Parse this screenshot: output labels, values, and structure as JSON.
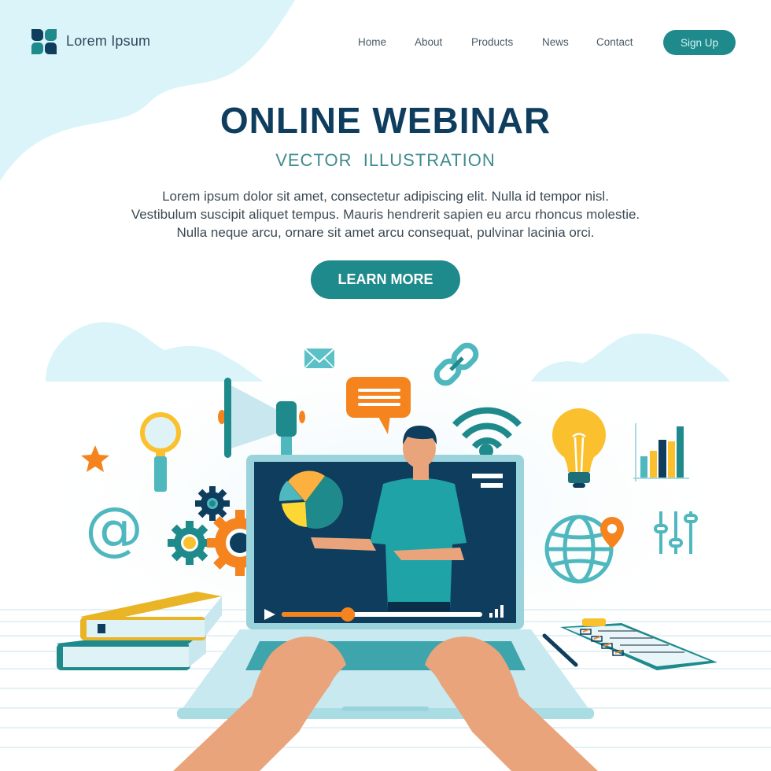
{
  "header": {
    "brand_name": "Lorem Ipsum",
    "logo_icon": "four-leaf-logo-icon",
    "nav": [
      {
        "label": "Home"
      },
      {
        "label": "About"
      },
      {
        "label": "Products"
      },
      {
        "label": "News"
      },
      {
        "label": "Contact"
      }
    ],
    "signup_label": "Sign Up"
  },
  "hero": {
    "title": "ONLINE WEBINAR",
    "subtitle": "VECTOR  ILLUSTRATION",
    "body_lines": [
      "Lorem ipsum dolor sit amet, consectetur adipiscing elit. Nulla id tempor nisl.",
      "Vestibulum suscipit aliquet tempus. Mauris hendrerit sapien eu arcu rhoncus molestie.",
      "Nulla neque arcu, ornare sit amet arcu consequat, pulvinar lacinia orci."
    ],
    "cta_label": "LEARN MORE"
  },
  "illustration": {
    "video_player": {
      "progress": 0.33,
      "play_icon": "play-icon",
      "volume_icon": "signal-bars-icon"
    },
    "icons": [
      "envelope-icon",
      "link-icon",
      "megaphone-icon",
      "chat-bubble-icon",
      "wifi-icon",
      "magnifier-icon",
      "star-icon",
      "at-sign-icon",
      "gears-icon",
      "lightbulb-icon",
      "bar-chart-icon",
      "globe-pin-icon",
      "sliders-icon",
      "books-icon",
      "pen-icon",
      "checklist-clipboard-icon",
      "laptop-icon",
      "hands-icon",
      "presenter-icon",
      "pie-chart-icon"
    ]
  },
  "colors": {
    "primary": "#1f8a8c",
    "navy": "#0f3d5e",
    "orange": "#f5841f",
    "yellow": "#fbc02d",
    "light_blue": "#daf4fa",
    "skin": "#e9a47c"
  }
}
